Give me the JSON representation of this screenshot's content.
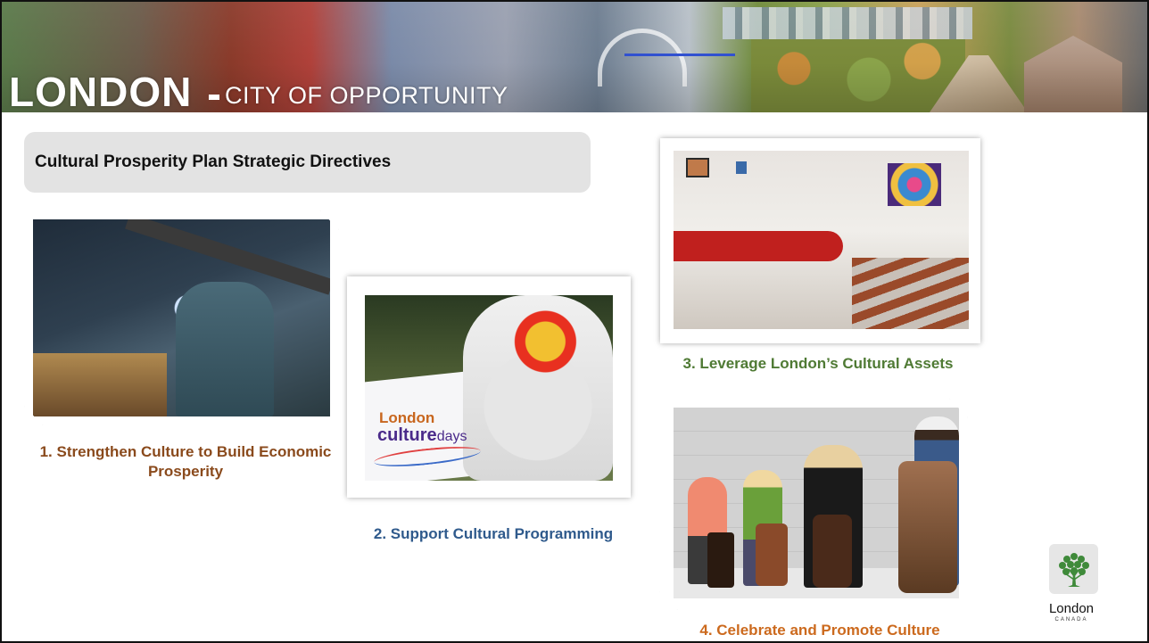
{
  "banner": {
    "title": "LONDON",
    "subtitle": "CITY OF OPPORTUNITY"
  },
  "heading": "Cultural Prosperity Plan Strategic Directives",
  "directives": [
    {
      "caption": "1. Strengthen Culture to Build Economic Prosperity",
      "color": "#8a4a1c"
    },
    {
      "caption": "2. Support Cultural Programming",
      "color": "#2f5a8c"
    },
    {
      "caption": "3. Leverage London’s Cultural Assets",
      "color": "#4f7a34"
    },
    {
      "caption": "4. Celebrate and Promote Culture",
      "color": "#cc6a1e"
    }
  ],
  "photo2_sign": {
    "line1": "London",
    "line2_bold": "culture",
    "line2_light": "days"
  },
  "logo": {
    "name": "London",
    "sub": "CANADA",
    "icon": "tree-icon"
  }
}
